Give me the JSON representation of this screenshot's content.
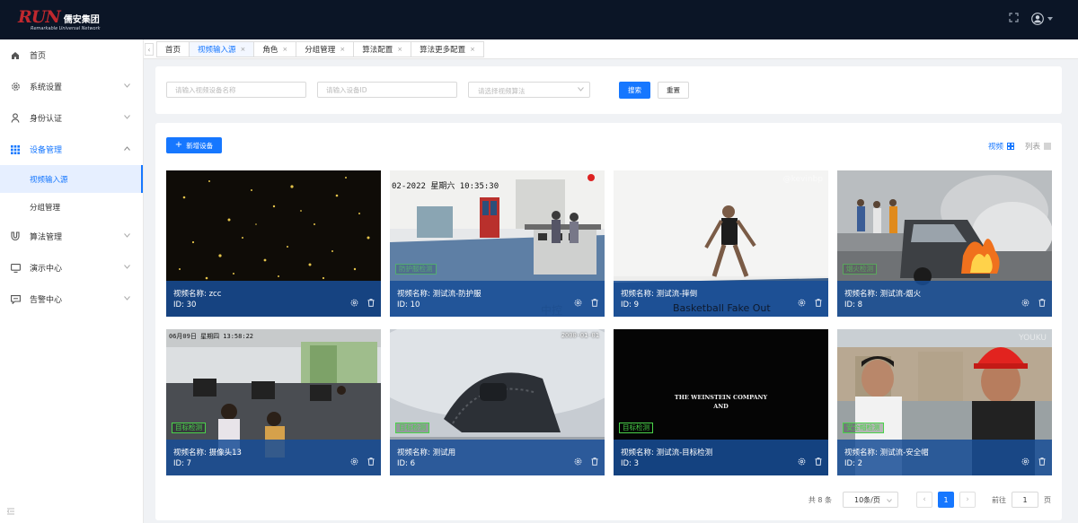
{
  "brand": {
    "logo_text": "RUN",
    "name": "儒安集团",
    "tagline": "Remarkable Universal Network"
  },
  "header": {
    "fullscreen_icon": "expand-icon",
    "avatar_icon": "user-avatar-icon"
  },
  "sidebar": {
    "items": [
      {
        "label": "首页",
        "icon": "home-icon"
      },
      {
        "label": "系统设置",
        "icon": "settings-icon"
      },
      {
        "label": "身份认证",
        "icon": "user-icon"
      },
      {
        "label": "设备管理",
        "icon": "grid-icon"
      },
      {
        "label": "算法管理",
        "icon": "magnet-icon"
      },
      {
        "label": "演示中心",
        "icon": "monitor-icon"
      },
      {
        "label": "告警中心",
        "icon": "chat-icon"
      }
    ],
    "subitems": [
      {
        "label": "视频输入源"
      },
      {
        "label": "分组管理"
      }
    ]
  },
  "tabs": [
    {
      "label": "首页"
    },
    {
      "label": "视频输入源"
    },
    {
      "label": "角色"
    },
    {
      "label": "分组管理"
    },
    {
      "label": "算法配置"
    },
    {
      "label": "算法更多配置"
    }
  ],
  "search": {
    "name_placeholder": "请输入视频设备名称",
    "id_placeholder": "请输入设备ID",
    "algo_placeholder": "请选择视频算法",
    "search_label": "搜索",
    "reset_label": "重置"
  },
  "main": {
    "add_label": "新增设备",
    "view_label": "视频",
    "list_label": "列表"
  },
  "cards": [
    {
      "name": "视频名称: zcc",
      "id": "ID: 30"
    },
    {
      "name": "视频名称: 测试流-防护服",
      "id": "ID: 10",
      "badge": "防护服检测",
      "timestamp": "02-2022 星期六 10:35:30"
    },
    {
      "name": "视频名称: 测试流-摔倒",
      "id": "ID: 9",
      "caption": "Basketball Fake Out",
      "watermark": "@kevinbp"
    },
    {
      "name": "视频名称: 测试流-烟火",
      "id": "ID: 8",
      "badge": "烟火检测"
    },
    {
      "name": "视频名称: 摄像头13",
      "id": "ID: 7",
      "badge": "目标检测",
      "timestamp": "06月09日 星期四 13:58:22"
    },
    {
      "name": "视频名称: 测试用",
      "id": "ID: 6",
      "badge": "目标检测",
      "timestamp": "2000-01-01"
    },
    {
      "name": "视频名称: 测试流-目标检测",
      "id": "ID: 3",
      "badge": "目标检测",
      "title_text": "THE WEINSTEIN COMPANY",
      "title_text2": "AND"
    },
    {
      "name": "视频名称: 测试流-安全帽",
      "id": "ID: 2",
      "badge": "安全帽检测",
      "watermark": "YOUKU"
    }
  ],
  "pager": {
    "total": "共 8 条",
    "page_size": "10条/页",
    "current": "1",
    "goto_label": "前往",
    "goto_value": "1",
    "page_unit": "页"
  },
  "colors": {
    "primary": "#1677ff",
    "topbar": "#0b1526",
    "overlay": "#184e96",
    "badge": "#4ad34a"
  }
}
